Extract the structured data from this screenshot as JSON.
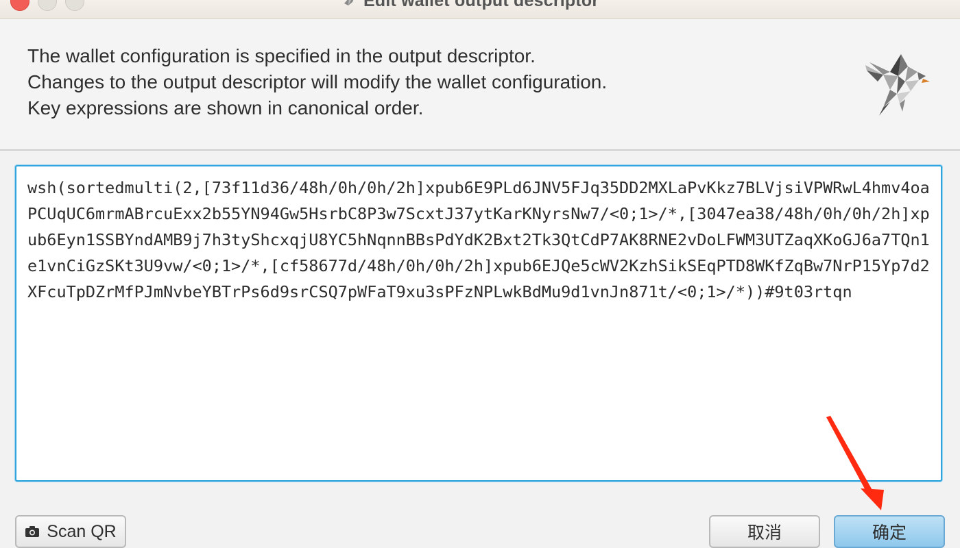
{
  "window": {
    "title": "Edit wallet output descriptor"
  },
  "header": {
    "lines": [
      "The wallet configuration is specified in the output descriptor.",
      "Changes to the output descriptor will modify the wallet configuration.",
      "Key expressions are shown in canonical order."
    ],
    "logo": "sparrow-bird-icon"
  },
  "editor": {
    "descriptor": "wsh(sortedmulti(2,[73f11d36/48h/0h/0h/2h]xpub6E9PLd6JNV5FJq35DD2MXLaPvKkz7BLVjsiVPWRwL4hmv4oaPCUqUC6mrmABrcuExx2b55YN94Gw5HsrbC8P3w7ScxtJ37ytKarKNyrsNw7/<0;1>/*,[3047ea38/48h/0h/0h/2h]xpub6Eyn1SSBYndAMB9j7h3tyShcxqjU8YC5hNqnnBBsPdYdK2Bxt2Tk3QtCdP7AK8RNE2vDoLFWM3UTZaqXKoGJ6a7TQn1e1vnCiGzSKt3U9vw/<0;1>/*,[cf58677d/48h/0h/0h/2h]xpub6EJQe5cWV2KzhSikSEqPTD8WKfZqBw7NrP15Yp7d2XFcuTpDZrMfPJmNvbeYBTrPs6d9srCSQ7pWFaT9xu3sPFzNPLwkBdMu9d1vnJn871t/<0;1>/*))#9t03rtqn"
  },
  "buttons": {
    "scan_qr": "Scan QR",
    "cancel": "取消",
    "ok": "确定"
  },
  "icons": {
    "camera": "camera-icon",
    "arrow": "red-arrow-annotation"
  },
  "colors": {
    "focus_border": "#2ea6dd",
    "ok_button": "#8ec8ec",
    "close_button": "#f25d55",
    "annotation_arrow": "#ff2a10"
  }
}
